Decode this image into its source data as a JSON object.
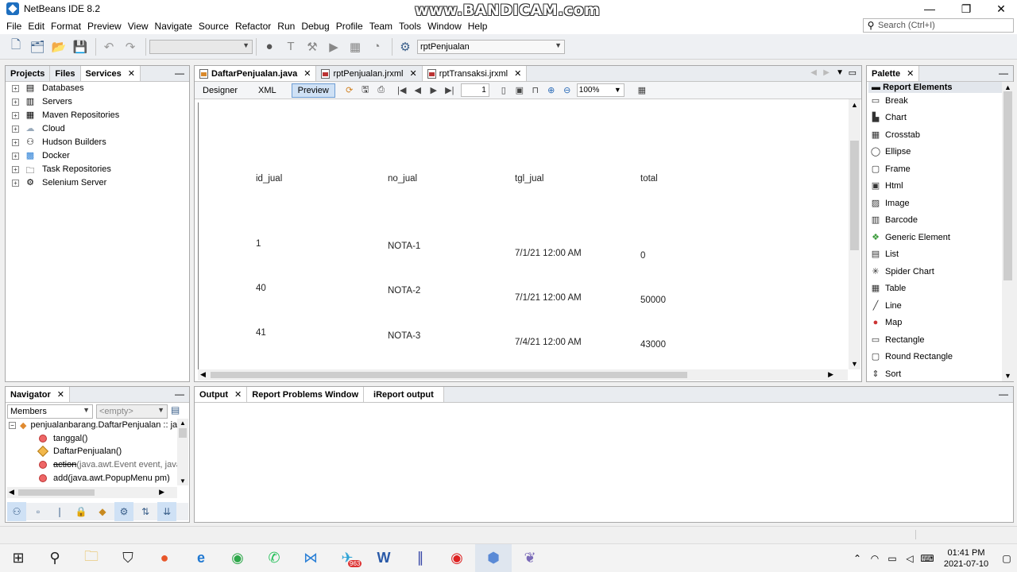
{
  "window": {
    "title": "NetBeans IDE 8.2",
    "watermark": "www.BANDICAM.com",
    "minimize": "—",
    "maximize": "❐",
    "close": "✕"
  },
  "menu": [
    "File",
    "Edit",
    "Format",
    "Preview",
    "View",
    "Navigate",
    "Source",
    "Refactor",
    "Run",
    "Debug",
    "Profile",
    "Team",
    "Tools",
    "Window",
    "Help"
  ],
  "search": {
    "placeholder": "Search (Ctrl+I)"
  },
  "toolbar": {
    "project_combo": "rptPenjualan"
  },
  "left_panel": {
    "tabs": [
      {
        "label": "Projects",
        "active": false
      },
      {
        "label": "Files",
        "active": false
      },
      {
        "label": "Services",
        "active": true,
        "close": "✕"
      }
    ],
    "items": [
      "Databases",
      "Servers",
      "Maven Repositories",
      "Cloud",
      "Hudson Builders",
      "Docker",
      "Task Repositories",
      "Selenium Server"
    ]
  },
  "editor": {
    "tabs": [
      {
        "label": "DaftarPenjualan.java",
        "active": true
      },
      {
        "label": "rptPenjualan.jrxml",
        "active": false
      },
      {
        "label": "rptTransaksi.jrxml",
        "active": false
      }
    ],
    "modes": [
      "Designer",
      "XML",
      "Preview"
    ],
    "active_mode": "Preview",
    "page_number": "1",
    "zoom": "100%"
  },
  "report": {
    "columns": [
      "id_jual",
      "no_jual",
      "tgl_jual",
      "total"
    ],
    "rows": [
      [
        "1",
        "NOTA-1",
        "7/1/21 12:00 AM",
        "0"
      ],
      [
        "40",
        "NOTA-2",
        "7/1/21 12:00 AM",
        "50000"
      ],
      [
        "41",
        "NOTA-3",
        "7/4/21 12:00 AM",
        "43000"
      ]
    ]
  },
  "palette": {
    "tab": "Palette",
    "section": "Report Elements",
    "items": [
      "Break",
      "Chart",
      "Crosstab",
      "Ellipse",
      "Frame",
      "Html",
      "Image",
      "Barcode",
      "Generic Element",
      "List",
      "Spider Chart",
      "Table",
      "Line",
      "Map",
      "Rectangle",
      "Round Rectangle",
      "Sort"
    ]
  },
  "navigator": {
    "tab": "Navigator",
    "filter": "Members",
    "empty": "<empty>",
    "root": "penjualanbarang.DaftarPenjualan :: ja",
    "members": [
      {
        "label": "tanggal()",
        "kind": "method"
      },
      {
        "label": "DaftarPenjualan()",
        "kind": "constructor"
      },
      {
        "label": "action",
        "suffix": "(java.awt.Event event, java",
        "kind": "deprecated"
      },
      {
        "label": "add(java.awt.PopupMenu pm)",
        "kind": "method"
      }
    ]
  },
  "output": {
    "tabs": [
      "Output",
      "Report Problems Window",
      "iReport output"
    ]
  },
  "taskbar": {
    "time": "01:41 PM",
    "date": "2021-07-10",
    "badge": "963"
  }
}
